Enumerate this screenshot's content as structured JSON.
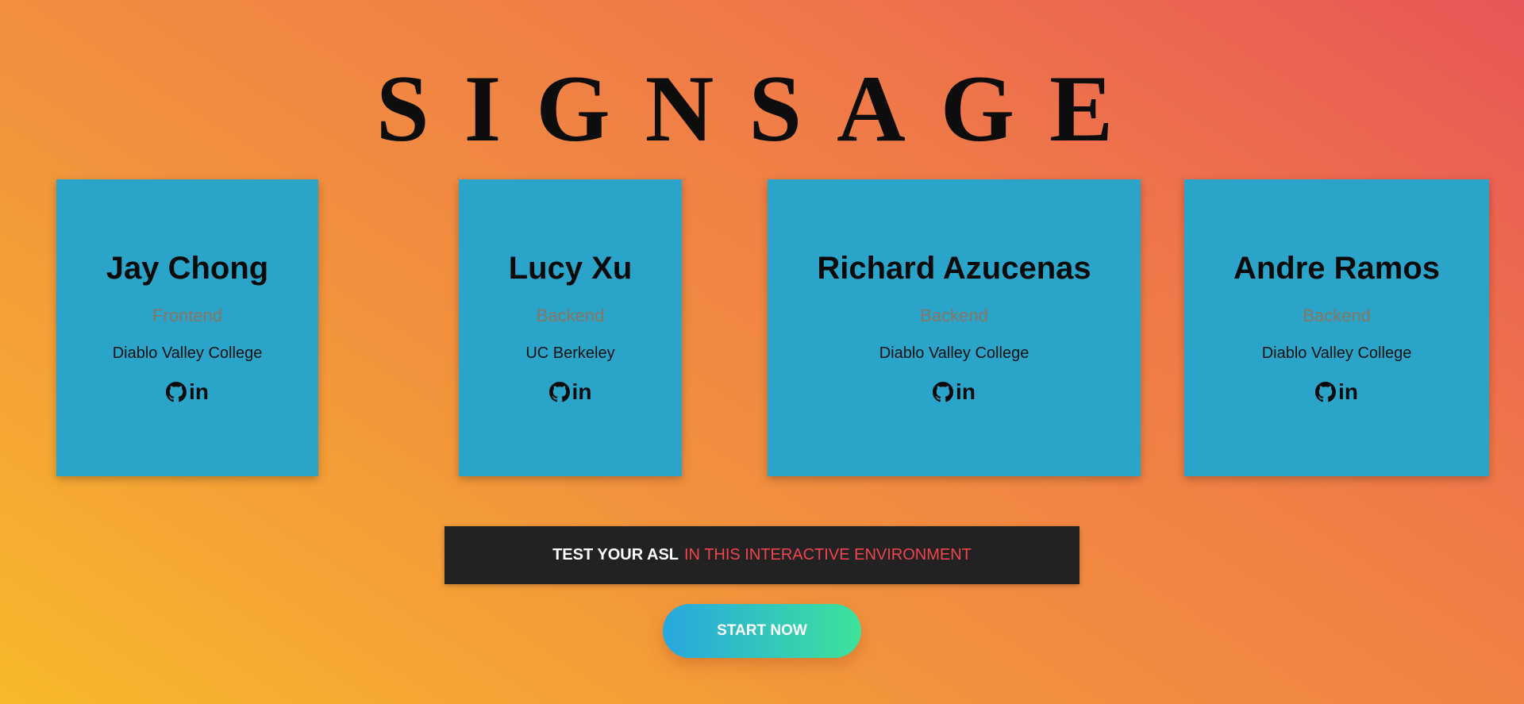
{
  "header": {
    "title": "SIGNSAGE"
  },
  "team": [
    {
      "name": "Jay Chong",
      "role": "Frontend",
      "school": "Diablo Valley College",
      "links": [
        "github-icon",
        "linkedin-icon"
      ]
    },
    {
      "name": "Lucy Xu",
      "role": "Backend",
      "school": "UC Berkeley",
      "links": [
        "github-icon",
        "linkedin-icon"
      ]
    },
    {
      "name": "Richard Azucenas",
      "role": "Backend",
      "school": "Diablo Valley College",
      "links": [
        "github-icon",
        "linkedin-icon"
      ]
    },
    {
      "name": "Andre Ramos",
      "role": "Backend",
      "school": "Diablo Valley College",
      "links": [
        "github-icon",
        "linkedin-icon"
      ]
    }
  ],
  "banner": {
    "strong": "TEST YOUR ASL",
    "accent": "IN THIS INTERACTIVE ENVIRONMENT"
  },
  "cta": {
    "label": "START NOW"
  },
  "icons": {
    "linkedin": "in"
  },
  "colors": {
    "card": "#2aa4c9",
    "banner_bg": "#222222",
    "banner_accent": "#f0444e",
    "role_text": "#8a7560",
    "cta_gradient_start": "#27a7df",
    "cta_gradient_end": "#3de39a"
  }
}
